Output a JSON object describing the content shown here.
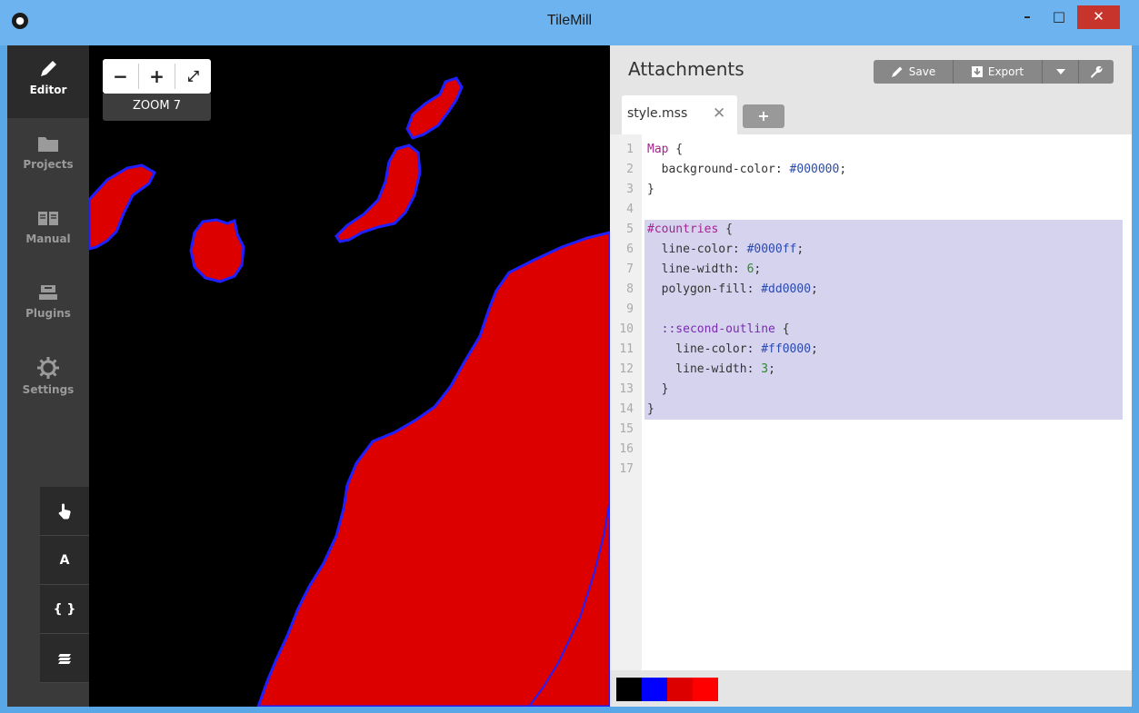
{
  "window": {
    "title": "TileMill"
  },
  "nav": {
    "items": [
      {
        "label": "Editor",
        "icon": "pencil-icon"
      },
      {
        "label": "Projects",
        "icon": "folder-icon"
      },
      {
        "label": "Manual",
        "icon": "book-icon"
      },
      {
        "label": "Plugins",
        "icon": "plugin-icon"
      },
      {
        "label": "Settings",
        "icon": "gear-icon"
      }
    ],
    "tools": [
      {
        "icon": "hand-icon",
        "label": ""
      },
      {
        "icon": "font-icon",
        "label": "A"
      },
      {
        "icon": "braces-icon",
        "label": "{ }"
      },
      {
        "icon": "layers-icon",
        "label": ""
      }
    ]
  },
  "map": {
    "zoom_out": "−",
    "zoom_in": "+",
    "fullscreen": "⤢",
    "zoom_label": "ZOOM 7",
    "colors": {
      "background": "#000000",
      "fill": "#dd0000",
      "outline": "#0000ff"
    }
  },
  "panel": {
    "title": "Attachments",
    "save_label": "Save",
    "export_label": "Export",
    "tab_name": "style.mss",
    "tab_close": "✕",
    "tab_add": "+"
  },
  "code": {
    "lines": [
      {
        "n": "1",
        "text": "Map {"
      },
      {
        "n": "2",
        "text": "  background-color: #000000;"
      },
      {
        "n": "3",
        "text": "}"
      },
      {
        "n": "4",
        "text": ""
      },
      {
        "n": "5",
        "text": "#countries {"
      },
      {
        "n": "6",
        "text": "  line-color: #0000ff;"
      },
      {
        "n": "7",
        "text": "  line-width: 6;"
      },
      {
        "n": "8",
        "text": "  polygon-fill: #dd0000;"
      },
      {
        "n": "9",
        "text": ""
      },
      {
        "n": "10",
        "text": "  ::second-outline {"
      },
      {
        "n": "11",
        "text": "    line-color: #ff0000;"
      },
      {
        "n": "12",
        "text": "    line-width: 3;"
      },
      {
        "n": "13",
        "text": "  }"
      },
      {
        "n": "14",
        "text": "}"
      },
      {
        "n": "15",
        "text": ""
      },
      {
        "n": "16",
        "text": ""
      },
      {
        "n": "17",
        "text": ""
      }
    ],
    "highlighted": [
      5,
      6,
      7,
      8,
      9,
      10,
      11,
      12,
      13,
      14
    ]
  },
  "palette": [
    "#000000",
    "#0000ff",
    "#dd0000",
    "#ff0000"
  ]
}
